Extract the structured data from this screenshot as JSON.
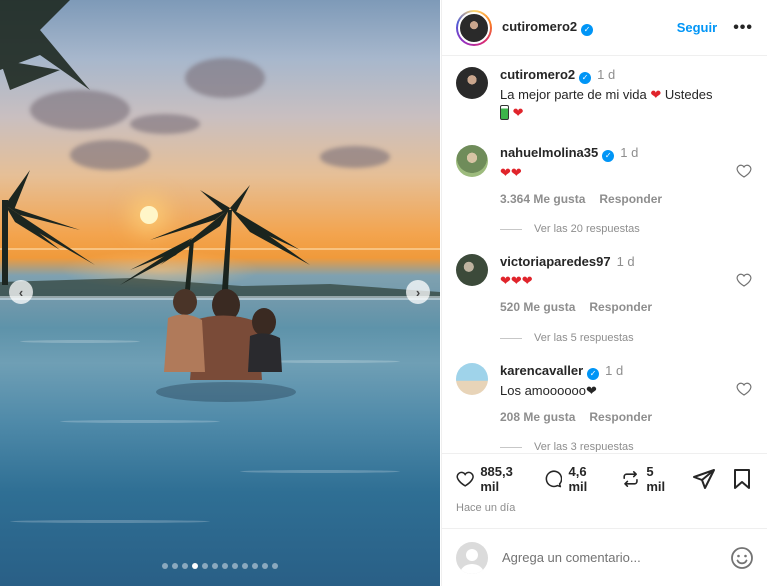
{
  "post": {
    "author": "cutiromero2",
    "follow_label": "Seguir",
    "more_label": "•••",
    "caption": {
      "username": "cutiromero2",
      "time": "1 d",
      "text": "La mejor parte de mi vida",
      "text2": "Ustedes"
    },
    "nav_prev": "‹",
    "nav_next": "›"
  },
  "comments": [
    {
      "username": "nahuelmolina35",
      "time": "1 d",
      "text": "❤❤",
      "likes": "3.364 Me gusta",
      "reply": "Responder",
      "view_replies": "Ver las 20 respuestas"
    },
    {
      "username": "victoriaparedes97",
      "time": "1 d",
      "text": "❤❤❤",
      "likes": "520 Me gusta",
      "reply": "Responder",
      "view_replies": "Ver las 5 respuestas"
    },
    {
      "username": "karencavaller",
      "time": "1 d",
      "text": "Los amoooooo❤",
      "likes": "208 Me gusta",
      "reply": "Responder",
      "view_replies": "Ver las 3 respuestas"
    }
  ],
  "actions": {
    "likes": "885,3 mil",
    "comments": "4,6 mil",
    "reposts": "5 mil",
    "time_ago": "Hace un día"
  },
  "add_comment": {
    "placeholder": "Agrega un comentario..."
  },
  "carousel": {
    "total": 12,
    "active_index": 3
  },
  "colors": {
    "accent": "#0095f6",
    "heart": "#e0242b",
    "text": "#262626",
    "muted": "#8e8e8e"
  },
  "icons": [
    "verified-badge-icon",
    "more-icon",
    "heart-icon",
    "comment-icon",
    "repost-icon",
    "share-icon",
    "bookmark-icon",
    "emoji-icon",
    "chevron-left-icon",
    "chevron-right-icon"
  ]
}
